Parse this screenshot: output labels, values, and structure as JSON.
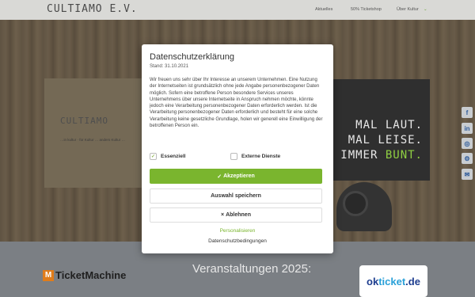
{
  "header": {
    "logo": "CULTIAMO E.V.",
    "nav": [
      "Aktuelles",
      "50% Ticketshop",
      "Über Kultur"
    ]
  },
  "hero": {
    "card_title": "CULTIAMO",
    "card_tagline": "…in kultur · für Kultur … anders Kultur …",
    "slogan_line1": "MAL LAUT.",
    "slogan_line2": "MAL LEISE.",
    "slogan_line3_prefix": "R IMMER ",
    "slogan_line3_accent": "BUNT."
  },
  "social": {
    "items": [
      {
        "icon": "facebook-icon",
        "glyph": "f"
      },
      {
        "icon": "linkedin-icon",
        "glyph": "in"
      },
      {
        "icon": "whatsapp-icon",
        "glyph": "◎"
      },
      {
        "icon": "settings-icon",
        "glyph": "⚙"
      },
      {
        "icon": "email-icon",
        "glyph": "✉"
      }
    ]
  },
  "bottom": {
    "ticketmachine": "TicketMachine",
    "ticketmachine_mark": "M",
    "events_title": "Veranstaltungen 2025:",
    "oktix_prefix": "ok",
    "oktix_main": "ticket",
    "oktix_suffix": ".de"
  },
  "modal": {
    "title": "Datenschutzerklärung",
    "date": "Stand: 31.10.2021",
    "body": "Wir freuen uns sehr über Ihr Interesse an unserem Unternehmen. Eine Nutzung der Internetseiten ist grundsätzlich ohne jede Angabe personenbezogener Daten möglich. Sofern eine betroffene Person besondere Services unseres Unternehmens über unsere Internetseite in Anspruch nehmen möchte, könnte jedoch eine Verarbeitung personenbezogener Daten erforderlich werden. Ist die Verarbeitung personenbezogener Daten erforderlich und besteht für eine solche Verarbeitung keine gesetzliche Grundlage, holen wir generell eine Einwilligung der betroffenen Person ein.",
    "checkbox_essential": "Essenziell",
    "checkbox_external": "Externe Dienste",
    "accept_label": "Akzeptieren",
    "save_label": "Auswahl speichern",
    "reject_label": "Ablehnen",
    "personalize_label": "Personalisieren",
    "privacy_label": "Datenschutzbedingungen",
    "accent_color": "#7ab52e"
  }
}
